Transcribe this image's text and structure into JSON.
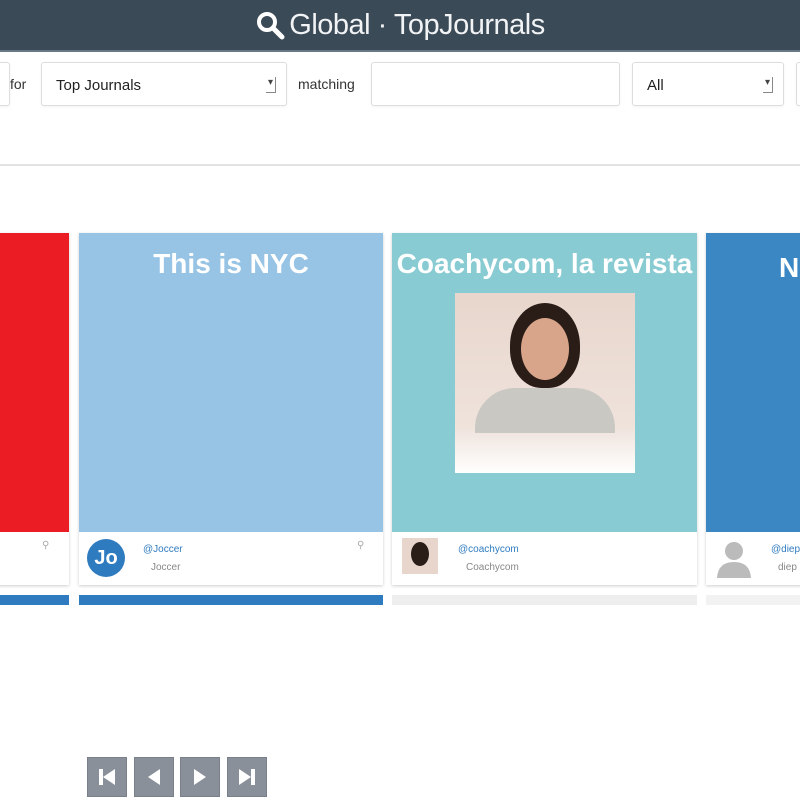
{
  "header": {
    "title": "Global · TopJournals",
    "icon": "search-icon"
  },
  "filters": {
    "for_label": "for",
    "category_value": "Top Journals",
    "matching_label": "matching",
    "matching_value": "",
    "matching_placeholder": "",
    "scope_value": "All"
  },
  "cards": [
    {
      "title": "",
      "color": "#ec1c24",
      "handle": "",
      "name": ""
    },
    {
      "title": "This is NYC",
      "color": "#97c3e5",
      "handle": "@Joccer",
      "name": "Joccer"
    },
    {
      "title": "Coachycom, la revista",
      "color": "#89cbd2",
      "handle": "@coachycom",
      "name": "Coachycom"
    },
    {
      "title": "N T",
      "color": "#3b87c4",
      "handle": "@diep",
      "name": "diep"
    }
  ],
  "pagination": [
    "first-page",
    "previous-page",
    "next-page",
    "last-page"
  ]
}
